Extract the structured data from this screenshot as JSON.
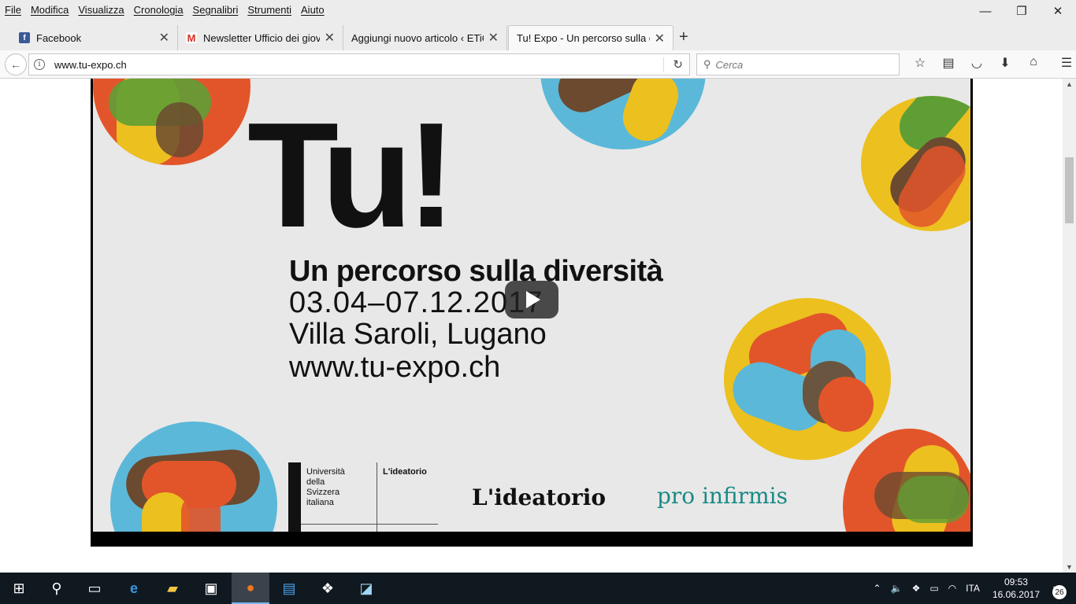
{
  "menubar": {
    "items": [
      "File",
      "Modifica",
      "Visualizza",
      "Cronologia",
      "Segnalibri",
      "Strumenti",
      "Aiuto"
    ]
  },
  "window_controls": {
    "minimize": "—",
    "restore": "❐",
    "close": "✕"
  },
  "tabs": [
    {
      "title": "Facebook",
      "icon": "facebook-icon",
      "active": false
    },
    {
      "title": "Newsletter Ufficio dei giovani",
      "icon": "gmail-icon",
      "active": false
    },
    {
      "title": "Aggiungi nuovo articolo ‹ ETiCinema",
      "icon": "",
      "active": false
    },
    {
      "title": "Tu! Expo - Un percorso sulla diversità",
      "icon": "",
      "active": true
    }
  ],
  "navbar": {
    "url": "www.tu-expo.ch",
    "search_placeholder": "Cerca"
  },
  "video": {
    "title_big": "Tu!",
    "subtitle": "Un percorso sulla diversità",
    "dates": "03.04–07.12.2017",
    "place": "Villa Saroli, Lugano",
    "website": "www.tu-expo.ch",
    "usi_text": "Università della Svizzera italiana",
    "ideatorio_small": "L'ideatorio",
    "ideatorio_logo": "L'ideatorio",
    "pro_infirmis": "pro infirmis"
  },
  "taskbar": {
    "time": "09:53",
    "date": "16.06.2017",
    "language": "ITA",
    "notifications": "26"
  },
  "colors": {
    "orange": "#e2552a",
    "blue": "#5bb8d8",
    "yellow": "#ecc01f",
    "green": "#5f9e35",
    "brown": "#6b4a30",
    "teal": "#1a8a84"
  }
}
